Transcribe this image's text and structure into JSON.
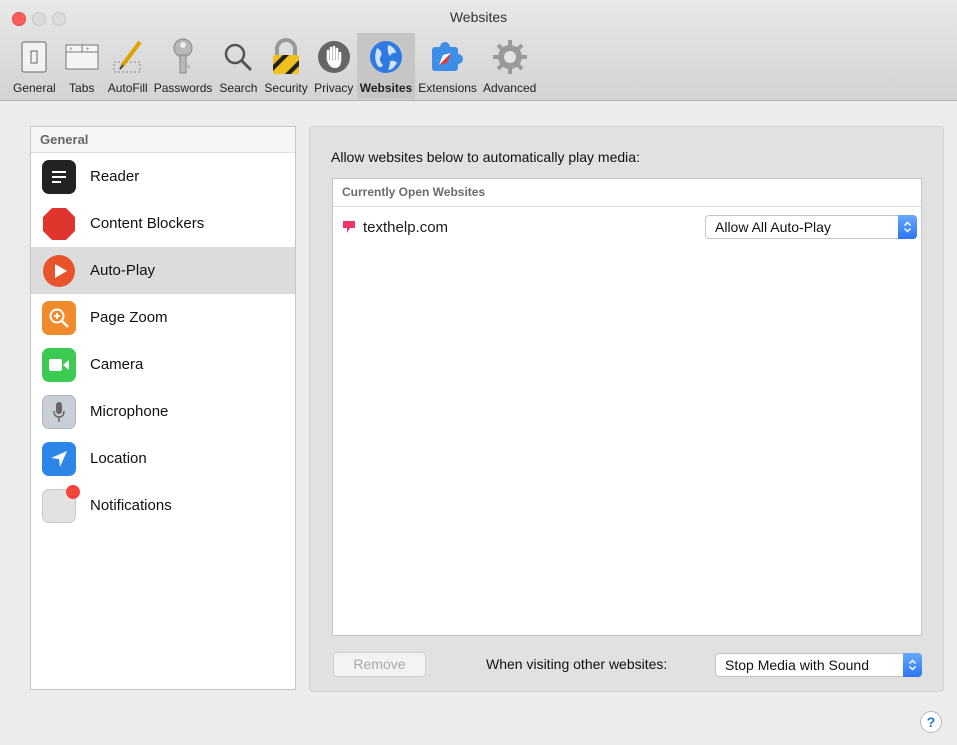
{
  "window": {
    "title": "Websites"
  },
  "toolbar": {
    "items": [
      {
        "label": "General",
        "icon": "general-icon"
      },
      {
        "label": "Tabs",
        "icon": "tabs-icon"
      },
      {
        "label": "AutoFill",
        "icon": "autofill-icon"
      },
      {
        "label": "Passwords",
        "icon": "key-icon"
      },
      {
        "label": "Search",
        "icon": "magnifier-icon"
      },
      {
        "label": "Security",
        "icon": "lock-icon"
      },
      {
        "label": "Privacy",
        "icon": "hand-icon"
      },
      {
        "label": "Websites",
        "icon": "globe-icon",
        "selected": true
      },
      {
        "label": "Extensions",
        "icon": "puzzle-icon"
      },
      {
        "label": "Advanced",
        "icon": "gear-icon"
      }
    ]
  },
  "sidebar": {
    "header": "General",
    "items": [
      {
        "label": "Reader",
        "icon": "reader-icon"
      },
      {
        "label": "Content Blockers",
        "icon": "stop-icon"
      },
      {
        "label": "Auto-Play",
        "icon": "play-icon",
        "selected": true
      },
      {
        "label": "Page Zoom",
        "icon": "zoom-icon"
      },
      {
        "label": "Camera",
        "icon": "camera-icon"
      },
      {
        "label": "Microphone",
        "icon": "microphone-icon"
      },
      {
        "label": "Location",
        "icon": "location-icon"
      },
      {
        "label": "Notifications",
        "icon": "notifications-icon"
      }
    ]
  },
  "main": {
    "prompt": "Allow websites below to automatically play media:",
    "table": {
      "header": "Currently Open Websites",
      "rows": [
        {
          "site": "texthelp.com",
          "setting": "Allow All Auto-Play"
        }
      ]
    },
    "remove_label": "Remove",
    "other_label": "When visiting other websites:",
    "other_setting": "Stop Media with Sound"
  },
  "help": {
    "label": "?"
  },
  "colors": {
    "accent": "#2b77f0",
    "close": "#fc5f57",
    "selection": "#dcdcdc"
  }
}
